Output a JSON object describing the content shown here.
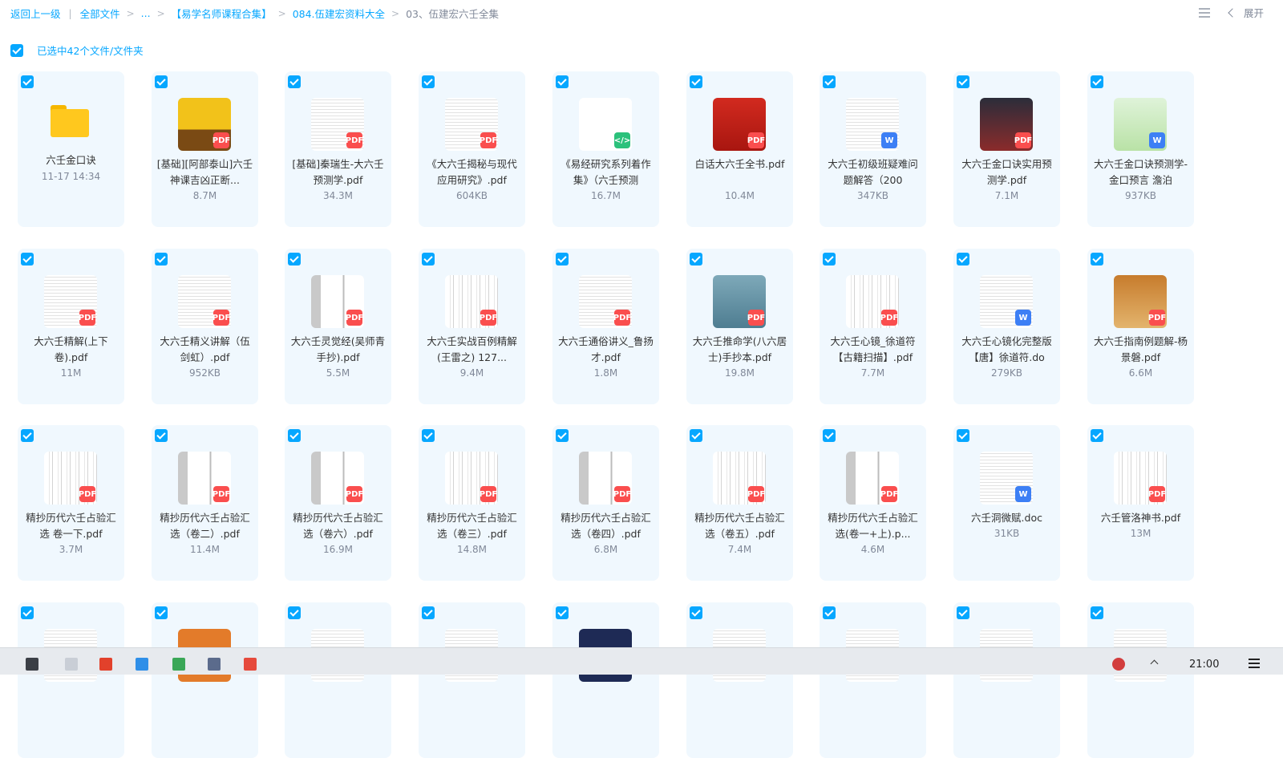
{
  "breadcrumb": {
    "back": "返回上一级",
    "all_files": "全部文件",
    "ellipsis": "...",
    "level1": "【易学名师课程合集】",
    "level2": "084.伍建宏资料大全",
    "current": "03、伍建宏六壬全集"
  },
  "header": {
    "expand_label": "展开"
  },
  "selection": {
    "label": "已选中42个文件/文件夹",
    "checked": true
  },
  "files": [
    {
      "name": "六壬金口诀",
      "meta": "11-17 14:34",
      "type": "folder",
      "thumb": "folder"
    },
    {
      "name": "[基础][阿部泰山]六壬神课吉凶正断...",
      "meta": "8.7M",
      "type": "pdf",
      "thumb": "cover-yellow"
    },
    {
      "name": "[基础]秦瑞生-大六壬预测学.pdf",
      "meta": "34.3M",
      "type": "pdf",
      "thumb": "text"
    },
    {
      "name": "《大六壬揭秘与现代应用研究》.pdf",
      "meta": "604KB",
      "type": "pdf",
      "thumb": "text"
    },
    {
      "name": "《易经研究系列着作集》（六壬预测",
      "meta": "16.7M",
      "type": "code",
      "thumb": "blank"
    },
    {
      "name": "白话大六壬全书.pdf",
      "meta": "10.4M",
      "type": "pdf",
      "thumb": "cover-red"
    },
    {
      "name": "大六壬初级班疑难问题解答（200",
      "meta": "347KB",
      "type": "doc",
      "thumb": "text"
    },
    {
      "name": "大六壬金口诀实用预测学.pdf",
      "meta": "7.1M",
      "type": "pdf",
      "thumb": "cover-dark"
    },
    {
      "name": "大六壬金口诀预测学-金口预言 澹泊",
      "meta": "937KB",
      "type": "doc",
      "thumb": "cover-green"
    },
    {
      "name": "大六壬精解(上下卷).pdf",
      "meta": "11M",
      "type": "pdf",
      "thumb": "text"
    },
    {
      "name": "大六壬精义讲解（伍剑虹）.pdf",
      "meta": "952KB",
      "type": "pdf",
      "thumb": "text"
    },
    {
      "name": "大六壬灵觉经(吴师青手抄).pdf",
      "meta": "5.5M",
      "type": "pdf",
      "thumb": "scan2"
    },
    {
      "name": "大六壬实战百例精解(王雷之) 127...",
      "meta": "9.4M",
      "type": "pdf",
      "thumb": "scan"
    },
    {
      "name": "大六壬通俗讲义_鲁扬才.pdf",
      "meta": "1.8M",
      "type": "pdf",
      "thumb": "text"
    },
    {
      "name": "大六壬推命学(八六居士)手抄本.pdf",
      "meta": "19.8M",
      "type": "pdf",
      "thumb": "cover-blue"
    },
    {
      "name": "大六壬心镜_徐道符【古籍扫描】.pdf",
      "meta": "7.7M",
      "type": "pdf",
      "thumb": "scan"
    },
    {
      "name": "大六壬心镜化完整版【唐】徐道符.do",
      "meta": "279KB",
      "type": "doc",
      "thumb": "text"
    },
    {
      "name": "大六壬指南例题解-杨景磐.pdf",
      "meta": "6.6M",
      "type": "pdf",
      "thumb": "cover-orange"
    },
    {
      "name": "精抄历代六壬占验汇选 卷一下.pdf",
      "meta": "3.7M",
      "type": "pdf",
      "thumb": "scan"
    },
    {
      "name": "精抄历代六壬占验汇选（卷二）.pdf",
      "meta": "11.4M",
      "type": "pdf",
      "thumb": "scan2"
    },
    {
      "name": "精抄历代六壬占验汇选（卷六）.pdf",
      "meta": "16.9M",
      "type": "pdf",
      "thumb": "scan2"
    },
    {
      "name": "精抄历代六壬占验汇选（卷三）.pdf",
      "meta": "14.8M",
      "type": "pdf",
      "thumb": "scan"
    },
    {
      "name": "精抄历代六壬占验汇选（卷四）.pdf",
      "meta": "6.8M",
      "type": "pdf",
      "thumb": "scan2"
    },
    {
      "name": "精抄历代六壬占验汇选（卷五）.pdf",
      "meta": "7.4M",
      "type": "pdf",
      "thumb": "scan"
    },
    {
      "name": "精抄历代六壬占验汇选(卷一+上).p...",
      "meta": "4.6M",
      "type": "pdf",
      "thumb": "scan2"
    },
    {
      "name": "六壬洞微赋.doc",
      "meta": "31KB",
      "type": "doc",
      "thumb": "text"
    },
    {
      "name": "六壬管洛神书.pdf",
      "meta": "13M",
      "type": "pdf",
      "thumb": "scan"
    },
    {
      "name": "",
      "meta": "",
      "type": "none",
      "thumb": "text"
    },
    {
      "name": "",
      "meta": "",
      "type": "none",
      "thumb": "cover-orange2"
    },
    {
      "name": "",
      "meta": "",
      "type": "none",
      "thumb": "text"
    },
    {
      "name": "",
      "meta": "",
      "type": "none",
      "thumb": "text"
    },
    {
      "name": "",
      "meta": "",
      "type": "none",
      "thumb": "cover-navy"
    },
    {
      "name": "",
      "meta": "",
      "type": "none",
      "thumb": "text"
    },
    {
      "name": "",
      "meta": "",
      "type": "none",
      "thumb": "text"
    },
    {
      "name": "",
      "meta": "",
      "type": "none",
      "thumb": "text"
    },
    {
      "name": "",
      "meta": "",
      "type": "none",
      "thumb": "text"
    }
  ],
  "badge_labels": {
    "pdf": "PDF",
    "doc": "W",
    "code": "</>"
  },
  "taskbar": {
    "clock": "21:00"
  },
  "colors": {
    "accent": "#06a7ff",
    "card_bg": "#f0f8fe",
    "pdf": "#fa4e4e",
    "doc": "#3d7ff5",
    "code": "#2bc17b"
  }
}
